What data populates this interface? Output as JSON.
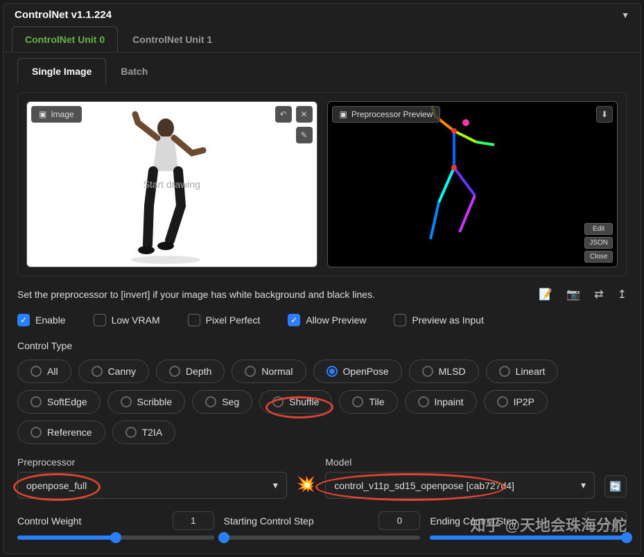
{
  "header": {
    "title": "ControlNet v1.1.224"
  },
  "tabs": {
    "unit0": "ControlNet Unit 0",
    "unit1": "ControlNet Unit 1"
  },
  "subtabs": {
    "single": "Single Image",
    "batch": "Batch"
  },
  "image_panel": {
    "left_label": "Image",
    "right_label": "Preprocessor Preview",
    "start_drawing": "Start drawing",
    "edit": "Edit",
    "json": "JSON",
    "close": "Close"
  },
  "hint": "Set the preprocessor to [invert] if your image has white background and black lines.",
  "checkboxes": {
    "enable": "Enable",
    "low_vram": "Low VRAM",
    "pixel_perfect": "Pixel Perfect",
    "allow_preview": "Allow Preview",
    "preview_as_input": "Preview as Input"
  },
  "control_type": {
    "label": "Control Type",
    "options": [
      "All",
      "Canny",
      "Depth",
      "Normal",
      "OpenPose",
      "MLSD",
      "Lineart",
      "SoftEdge",
      "Scribble",
      "Seg",
      "Shuffle",
      "Tile",
      "Inpaint",
      "IP2P",
      "Reference",
      "T2IA"
    ]
  },
  "preprocessor": {
    "label": "Preprocessor",
    "value": "openpose_full"
  },
  "model": {
    "label": "Model",
    "value": "control_v11p_sd15_openpose [cab727d4]"
  },
  "sliders": {
    "weight": {
      "label": "Control Weight",
      "value": "1"
    },
    "start": {
      "label": "Starting Control Step",
      "value": "0"
    },
    "end": {
      "label": "Ending Control Step",
      "value": "1"
    }
  },
  "watermark": "知乎 @天地会珠海分舵"
}
